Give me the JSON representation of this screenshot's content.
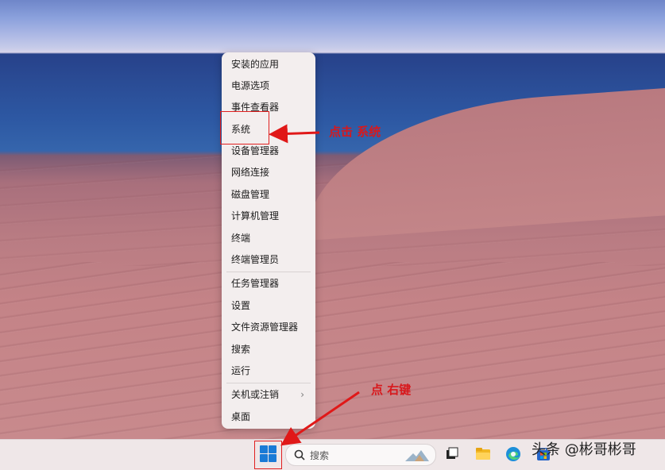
{
  "context_menu": {
    "items": [
      {
        "label": "安装的应用"
      },
      {
        "label": "电源选项"
      },
      {
        "label": "事件查看器"
      },
      {
        "label": "系统"
      },
      {
        "label": "设备管理器"
      },
      {
        "label": "网络连接"
      },
      {
        "label": "磁盘管理"
      },
      {
        "label": "计算机管理"
      },
      {
        "label": "终端"
      },
      {
        "label": "终端管理员"
      },
      {
        "label": "任务管理器"
      },
      {
        "label": "设置"
      },
      {
        "label": "文件资源管理器"
      },
      {
        "label": "搜索"
      },
      {
        "label": "运行"
      },
      {
        "label": "关机或注销",
        "submenu_icon": "chevron-right-icon"
      },
      {
        "label": "桌面"
      }
    ]
  },
  "annotations": {
    "click_system": "点击 系统",
    "right_click": "点 右键",
    "color": "#d8181c"
  },
  "taskbar": {
    "start_icon": "windows-logo-icon",
    "search_placeholder": "搜索",
    "icons": [
      "task-view-icon",
      "file-explorer-icon",
      "edge-icon",
      "store-icon"
    ]
  },
  "watermark": "头条 @彬哥彬哥"
}
